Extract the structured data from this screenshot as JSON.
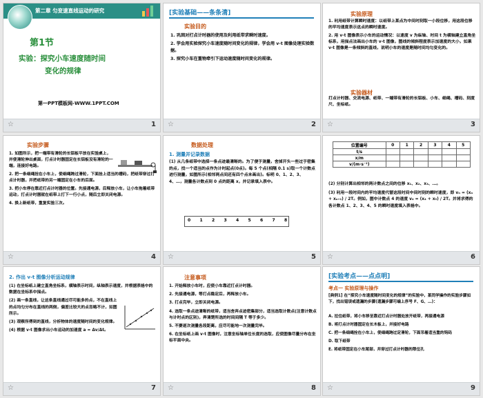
{
  "slides": [
    {
      "number": "1",
      "banner": "第二章  匀变速直线运动的研究",
      "section": "第1节",
      "title_line1": "实验：探究小车速度随时间",
      "title_line2": "变化的规律",
      "source": "第一PPT模板网-WWW.1PPT.COM"
    },
    {
      "number": "2",
      "header": "[实验基础——条条清]",
      "subhead": "实验目的",
      "items": [
        "1.  巩固对打点计时器的使用及利用纸带求瞬时速度。",
        "2.  学会用实验探究小车速度随时间变化的规律，学会用 v-t 图像处理实验数据。",
        "3.  探究小车在重物牵引下运动速度随时间变化的规律。"
      ]
    },
    {
      "number": "3",
      "subhead": "实验原理",
      "items": [
        "1.  利用纸带计算瞬时速度：以纸带上某点为中间时刻取一小段位移，用这段位移的平均速度表示这点的瞬时速度。",
        "2.  用 v-t 图像表示小车的运动情况：以速度 v 为纵轴、时间 t 为横轴建立直角坐标系，用描点法画出小车的 v-t 图像，图线的倾斜程度表示加速度的大小，如果 v-t 图像是一条倾斜的直线，说明小车的速度是随时间均匀变化的。"
      ],
      "subhead2": "实验器材",
      "equipment": "打点计时器、交流电源、纸带、一端带有滑轮的长铝板、小车、细绳、槽码、刻度尺、坐标纸。"
    },
    {
      "number": "4",
      "subhead": "实验步骤",
      "items": [
        "1.  如图所示，把一端带有滑轮的长铝板平放在实验桌上，并使滑轮伸出桌面，打点计时器固定在长铝板没有滑轮的一端，连接好电路。",
        "2.  把一条细绳拴在小车上，使细绳跨过滑轮，下面挂上适当的槽码，把纸带穿过打点计时器，并把纸带的另一端固定在小车的后面。",
        "3.  把小车停在靠近打点计时器的位置。先接通电源，后释放小车，让小车拖着纸带运动，打点计时器就在纸带上打下一行小点，随后立即关闭电源。",
        "4.  换上新纸带，重复实验三次。"
      ]
    },
    {
      "number": "5",
      "subhead": "数据处理",
      "point1": "1.  测量并记录数据",
      "text": "(1) 从几条纸带中选择一条点迹最清晰的。为了便于测量，舍掉开头一些过于密集的点，找一个适当的点作为计时起点(0点)。每 5 个点(相隔 0.1 s)取一个计数点进行测量，如图所示(相邻两点间还有四个点未画出)。标明 0、1、2、3、4、…，测量各计数点到 0 点的距离 x，并记录填入表中。",
      "tape_labels": [
        "0",
        "1",
        "2",
        "3",
        "4",
        "5",
        "6",
        "7",
        "8"
      ]
    },
    {
      "number": "6",
      "table_header": [
        "位置编号",
        "0",
        "1",
        "2",
        "3",
        "4",
        "5"
      ],
      "table_rows": [
        "t/s",
        "x/m",
        "v/(m·s⁻¹)"
      ],
      "text1": "(2) 分别计算出相邻的两计数点之间的位移 x₁、x₂、x₃、…。",
      "text2": "(3) 利用一段时间内的平均速度代替这段时间中间时刻的瞬时速度，即 vₙ = (xₙ + xₙ₊₁) / 2T。例如，图中计数点 4 的速度 v₄ = (x₄ + x₅) / 2T。并将求得的各计数点 1、2、3、4、5 的瞬时速度填入表格中。"
    },
    {
      "number": "7",
      "point2": "2.  作出 v-t 图像分析运动规律",
      "items": [
        "(1) 在坐标纸上建立直角坐标系，横轴表示时间，纵轴表示速度，并根据表格中的数据在坐标系中描点。",
        "(2) 画一条直线，让这条直线通过尽可能多的点，不在直线上的点均匀分布在直线的两侧，偏差比较大的点忽略不计，如图所示。",
        "(3) 观察所得到的直线，分析物体的速度随时间的变化规律。",
        "(4) 根据 v-t 图像求出小车运动的加速度 a = Δv/Δt。"
      ]
    },
    {
      "number": "8",
      "subhead": "注意事项",
      "items": [
        "1.  开始释放小车时，应使小车靠近打点计时器。",
        "2.  先接通电源，等打点稳定后，再释放小车。",
        "3.  打点完毕，立即关闭电源。",
        "4.  选取一条点迹清晰的纸带，适当舍弃点迹密集部分，适当选取计数点(注意计数点与计时点的区别)，弄清楚所选的时间间隔 T 等于多少。",
        "5.  不要逐次测量各段距离，应尽可能地一次测量完毕。",
        "6.  在坐标纸上画 v-t 图像时，注意坐标轴单位长度的选取，应使图像尽量分布在坐标平面中央。"
      ]
    },
    {
      "number": "9",
      "header": "[实验考点——点点明]",
      "point": "考点一    实验原理与操作",
      "example": "[典例1]  在“探究小车速度随时间变化的规律”的实验中，某同学操作的实验步骤如下，找出错误或遗漏的步骤(遗漏步骤可编上序号 F、G、…)：",
      "options": [
        "A.  拉住纸带，将小车移至靠近打点计时器处放开纸带，再接通电源",
        "B.  将打点计时器固定在长木板上，并接好电路",
        "C.  把一条细绳拴在小车上，使细绳跨过定滑轮，下面吊着适当重的钩码",
        "D.  取下纸带",
        "E.  将纸带固定在小车尾部，并穿过打点计时器的限位孔"
      ]
    }
  ],
  "footer_icon": "star-icon",
  "colors": {
    "accent_blue": "#1f7fb8",
    "title_green": "#2a8f3c",
    "subhead_orange": "#c55a1c",
    "banner_teal": "#2b8f86"
  }
}
